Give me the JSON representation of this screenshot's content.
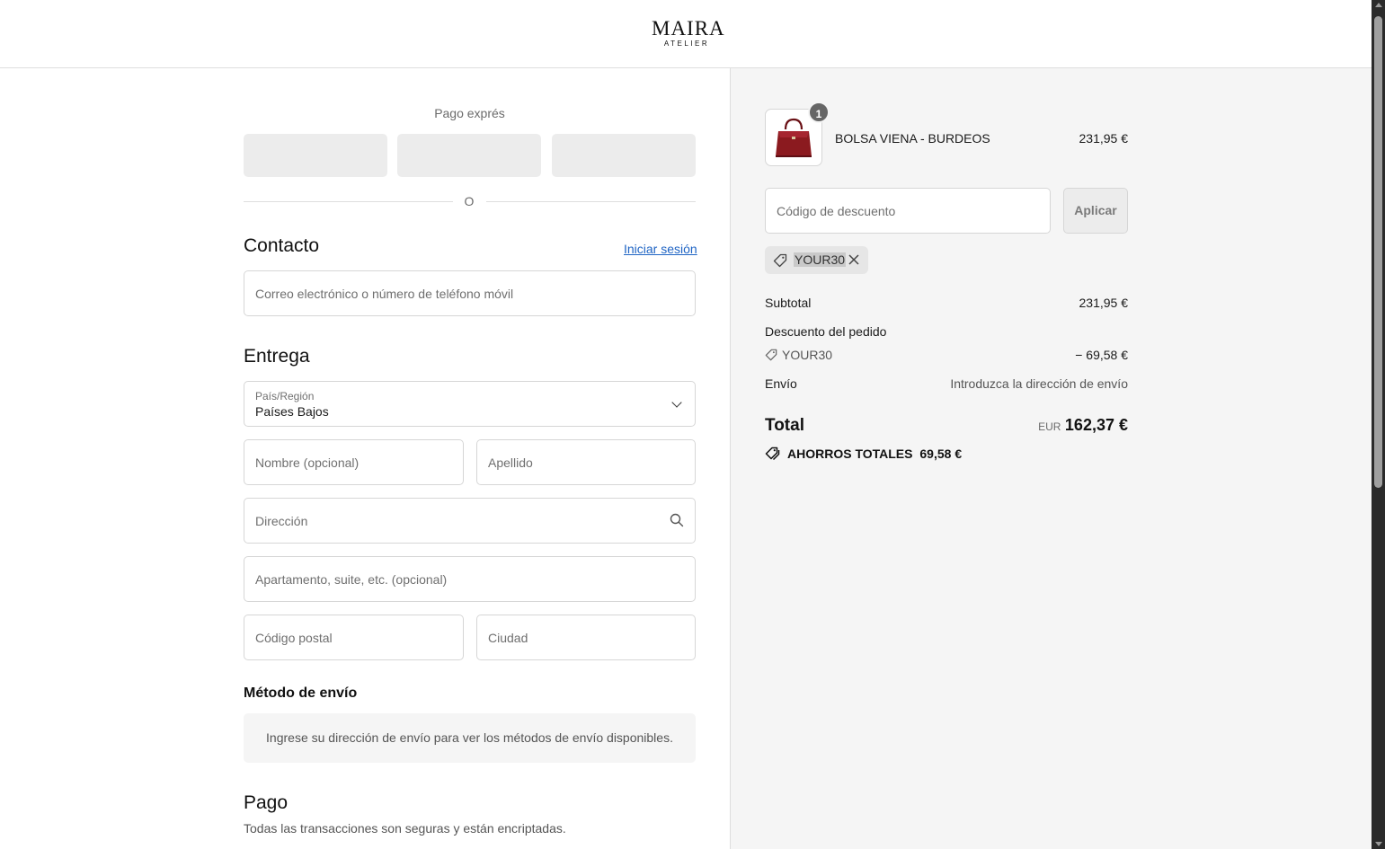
{
  "brand": {
    "name": "MAIRA",
    "sub": "ATELIER"
  },
  "express": {
    "label": "Pago exprés",
    "divider": "O"
  },
  "contact": {
    "title": "Contacto",
    "login_link": "Iniciar sesión",
    "email_placeholder": "Correo electrónico o número de teléfono móvil"
  },
  "delivery": {
    "title": "Entrega",
    "country_label": "País/Región",
    "country_value": "Países Bajos",
    "first_name_placeholder": "Nombre (opcional)",
    "last_name_placeholder": "Apellido",
    "address_placeholder": "Dirección",
    "apartment_placeholder": "Apartamento, suite, etc. (opcional)",
    "postal_placeholder": "Código postal",
    "city_placeholder": "Ciudad"
  },
  "shipping_method": {
    "title": "Método de envío",
    "message": "Ingrese su dirección de envío para ver los métodos de envío disponibles."
  },
  "payment": {
    "title": "Pago",
    "subtitle": "Todas las transacciones son seguras y están encriptadas."
  },
  "cart": {
    "item": {
      "quantity": "1",
      "name": "BOLSA VIENA - BURDEOS",
      "price": "231,95 €"
    },
    "discount_placeholder": "Código de descuento",
    "apply_label": "Aplicar",
    "applied_code": "YOUR30",
    "subtotal_label": "Subtotal",
    "subtotal_value": "231,95 €",
    "order_discount_label": "Descuento del pedido",
    "discount_code": "YOUR30",
    "discount_value": "− 69,58 €",
    "shipping_label": "Envío",
    "shipping_value": "Introduzca la dirección de envío",
    "total_label": "Total",
    "total_currency": "EUR",
    "total_value": "162,37 €",
    "savings_label": "AHORROS TOTALES",
    "savings_value": "69,58 €"
  },
  "colors": {
    "link": "#1f64c4",
    "bag": "#8b1a1f",
    "summary_bg": "#f5f5f5"
  }
}
